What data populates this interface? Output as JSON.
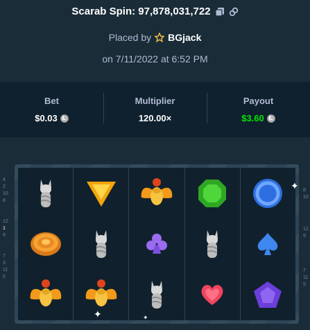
{
  "header": {
    "title": "Scarab Spin: 97,878,031,722",
    "placed_prefix": "Placed by",
    "username": "BGjack",
    "date": "on 7/11/2022 at 6:52 PM"
  },
  "stats": {
    "bet_label": "Bet",
    "bet_value": "$0.03",
    "multiplier_label": "Multiplier",
    "multiplier_value": "120.00×",
    "payout_label": "Payout",
    "payout_value": "$3.60"
  },
  "paylines": {
    "left": [
      "4",
      "2",
      "10",
      "8",
      "",
      "12",
      "1",
      "9",
      "",
      "7",
      "3",
      "11",
      "5"
    ],
    "right": [
      "8",
      "10",
      "",
      "",
      "12",
      "9",
      "",
      "",
      "7",
      "11",
      "5"
    ]
  },
  "reels": [
    [
      "cat-statue",
      "orange-scarab-medallion",
      "golden-scarab"
    ],
    [
      "yellow-triangle-gem",
      "cat-statue",
      "golden-scarab"
    ],
    [
      "golden-scarab",
      "purple-club",
      "cat-statue"
    ],
    [
      "green-gem",
      "cat-statue",
      "red-heart"
    ],
    [
      "blue-ring-gem",
      "blue-spade",
      "purple-pentagon-gem"
    ]
  ],
  "colors": {
    "background": "#1a2c38",
    "panel": "#0f212e",
    "payout_green": "#00e701",
    "muted_text": "#b1bad3"
  }
}
